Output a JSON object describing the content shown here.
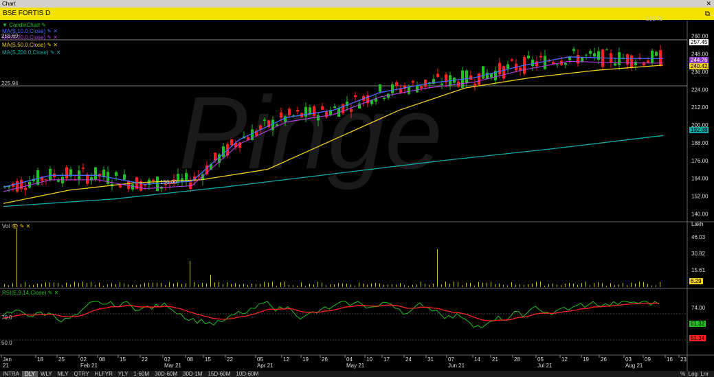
{
  "window": {
    "title": "Chart"
  },
  "header": {
    "symbol": "BSE FORTIS D"
  },
  "legend": {
    "candle": "CandleChart",
    "ma10": "MA(S,10.0,Close)",
    "ma20": "MA(S,20.0,Close)",
    "ma50": "MA(S,50.0,Close)",
    "ma200": "MA(S,200.0,Close)",
    "vol": "Vol",
    "rsi": "RSI(E,9,14,Close)"
  },
  "price_labels": {
    "high": "260.70",
    "high_left": "259.69",
    "low": "156.00",
    "left_level": "225.94",
    "last": "257.45",
    "ma10": "244.76",
    "ma50": "240.42",
    "ma200": "192.88"
  },
  "vol_unit": "Lakh",
  "vol_last": "6.29",
  "rsi_labels": {
    "upper": "70.0",
    "lower": "50.0",
    "rsi_last": "61.32",
    "signal_last": "51.34"
  },
  "colors": {
    "up": "#1fc01f",
    "down": "#ff2020",
    "ma10": "#4a6bff",
    "ma20": "#b040e0",
    "ma50": "#f0d020",
    "ma200": "#10a8a8"
  },
  "chart_data": [
    {
      "type": "line",
      "title": "BSE FORTIS D",
      "ylim": [
        136,
        264
      ],
      "yticks": [
        "260.00",
        "248.00",
        "236.00",
        "224.00",
        "212.00",
        "200.00",
        "188.00",
        "176.00",
        "164.00",
        "152.00",
        "140.00"
      ],
      "xticks": [
        "Jan 21",
        "18",
        "25",
        "02 Feb 21",
        "08",
        "15",
        "22",
        "02 Mar 21",
        "08",
        "15",
        "22",
        "05 Apr 21",
        "12",
        "19",
        "26",
        "04 May 21",
        "10",
        "17",
        "24",
        "31",
        "07 Jun 21",
        "14",
        "21",
        "28",
        "05 Jul 21",
        "12",
        "19",
        "26",
        "03 Aug 21",
        "09",
        "16",
        "23"
      ],
      "series": [
        {
          "name": "MA(S,200.0,Close)",
          "values": [
            145,
            150,
            158,
            167,
            176,
            184,
            192.9
          ]
        },
        {
          "name": "MA(S,50.0,Close)",
          "values": [
            147,
            156,
            161,
            163,
            170,
            190,
            210,
            225,
            232,
            237,
            240.4
          ]
        },
        {
          "name": "MA(S,10.0,Close)",
          "values": [
            158,
            166,
            166,
            160,
            162,
            190,
            205,
            210,
            222,
            228,
            232,
            240,
            246,
            245,
            244.8
          ]
        }
      ]
    },
    {
      "type": "bar",
      "title": "Vol",
      "ylim": [
        0,
        56
      ],
      "yticks": [
        "46.03",
        "30.82",
        "15.61",
        "6.29"
      ]
    },
    {
      "type": "line",
      "title": "RSI(E,9,14,Close)",
      "ylim": [
        30,
        90
      ],
      "yticks": [
        "74.00",
        "61.32",
        "51.34"
      ]
    }
  ]
}
